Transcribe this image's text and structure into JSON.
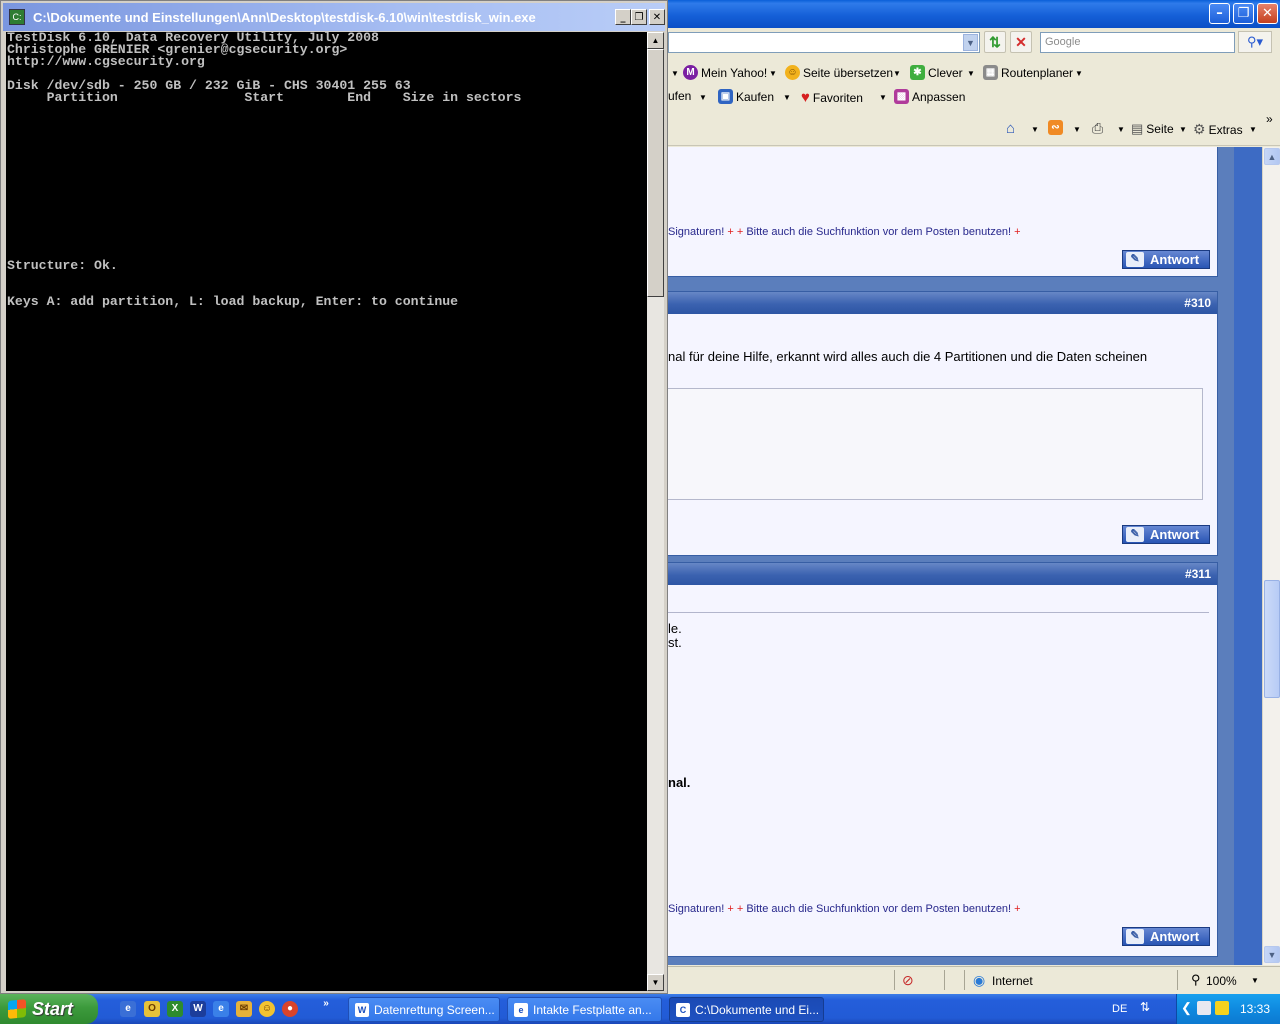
{
  "ie": {
    "search_placeholder": "Google",
    "links": {
      "mein_yahoo": "Mein Yahoo!",
      "translate": "Seite übersetzen",
      "clever": "Clever",
      "route": "Routenplaner",
      "kaufen_cut": "ufen",
      "kaufen": "Kaufen",
      "favoriten": "Favoriten",
      "anpassen": "Anpassen"
    },
    "commands": {
      "seite": "Seite",
      "extras": "Extras"
    },
    "posts": {
      "sig_text": "Signaturen!",
      "sig_text2": "Bitte auch die Suchfunktion vor dem Posten benutzen!",
      "plus": "+",
      "reply": "Antwort",
      "post310_num": "#310",
      "post310_text": "nal für deine Hilfe, erkannt wird alles auch die 4 Partitionen und die Daten scheinen",
      "post311_num": "#311",
      "post311_line1": "le.",
      "post311_line2": "st.",
      "post311_bold": "nal."
    },
    "status": {
      "zone": "Internet",
      "zoom": "100%"
    }
  },
  "console": {
    "title": "C:\\Dokumente und Einstellungen\\Ann\\Desktop\\testdisk-6.10\\win\\testdisk_win.exe",
    "lines": [
      "TestDisk 6.10, Data Recovery Utility, July 2008",
      "Christophe GRENIER <grenier@cgsecurity.org>",
      "http://www.cgsecurity.org",
      "Disk /dev/sdb - 250 GB / 232 GiB - CHS 30401 255 63",
      "     Partition                Start        End    Size in sectors",
      "Structure: Ok.",
      "Keys A: add partition, L: load backup, Enter: to continue"
    ]
  },
  "taskbar": {
    "start": "Start",
    "chevron": "»",
    "tasks": [
      {
        "label": "Datenrettung Screen...",
        "icon": "word-icon"
      },
      {
        "label": "Intakte Festplatte an...",
        "icon": "ie-icon"
      },
      {
        "label": "C:\\Dokumente und Ei...",
        "icon": "console-icon"
      }
    ],
    "lang": "DE",
    "clock": "13:33"
  }
}
